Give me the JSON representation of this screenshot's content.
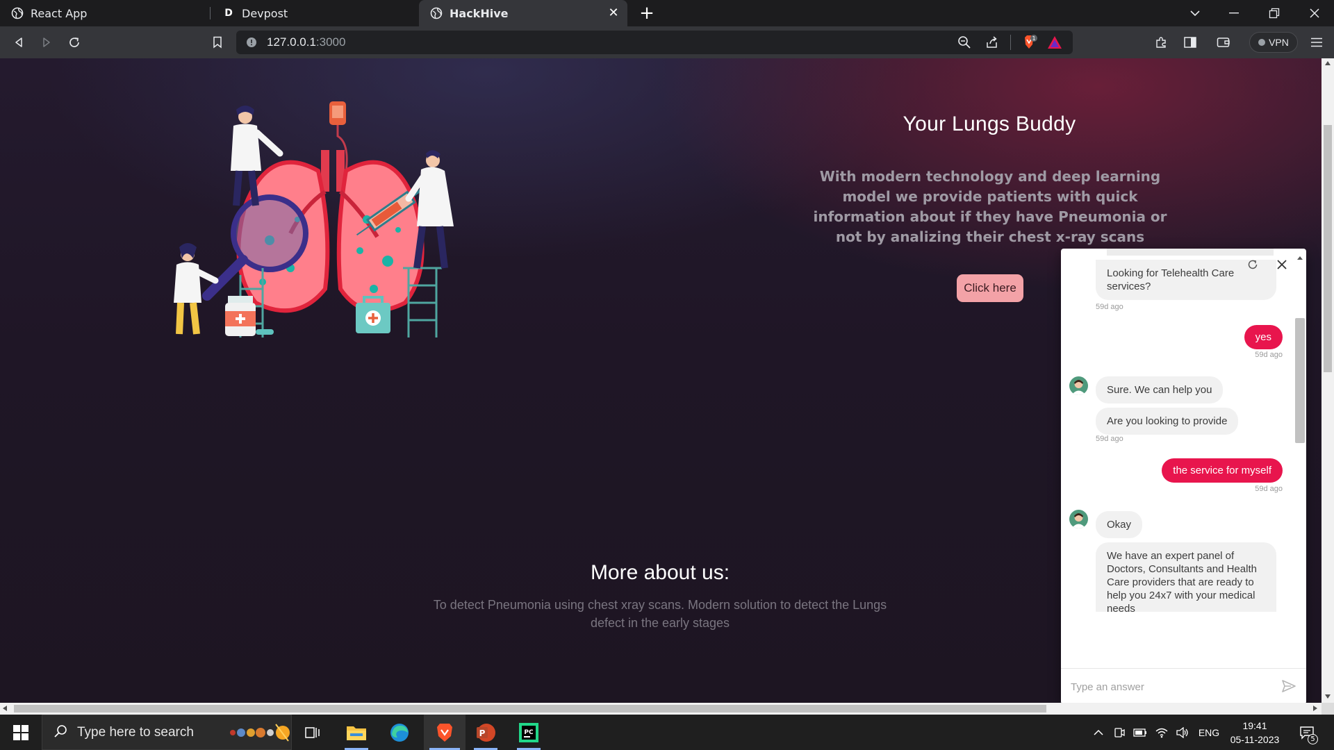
{
  "browser": {
    "tabs": [
      {
        "label": "React App",
        "icon": "globe-icon"
      },
      {
        "label": "Devpost",
        "icon": "devpost-d-icon",
        "icon_letter": "D"
      },
      {
        "label": "HackHive",
        "icon": "globe-icon",
        "active": true
      }
    ],
    "url_host": "127.0.0.1",
    "url_port": ":3000",
    "vpn_label": "VPN",
    "shield_count": "1"
  },
  "hero": {
    "title": "Your Lungs Buddy",
    "description": "With modern technology and deep learning model we provide patients with quick information about if they have Pneumonia or not by analizing their chest x-ray scans",
    "cta_label": "Click here"
  },
  "about": {
    "title": "More about us:",
    "description": "To detect Pneumonia using chest xray scans. Modern solution to detect the Lungs defect in the early stages"
  },
  "chat": {
    "messages": [
      {
        "from": "agent",
        "text": "Looking for Telehealth Care services?",
        "time": "59d ago"
      },
      {
        "from": "user",
        "text": "yes",
        "time": "59d ago"
      },
      {
        "from": "agent",
        "text": "Sure. We can help you"
      },
      {
        "from": "agent",
        "text": "Are you looking to provide",
        "time": "59d ago"
      },
      {
        "from": "user",
        "text": "the service for myself",
        "time": "59d ago"
      },
      {
        "from": "agent",
        "text": "Okay"
      },
      {
        "from": "agent",
        "text": "We have an expert panel of Doctors, Consultants and Health Care providers that are ready to help you 24x7 with your medical needs"
      }
    ],
    "input_placeholder": "Type an answer"
  },
  "taskbar": {
    "search_placeholder": "Type here to search",
    "language": "ENG",
    "time": "19:41",
    "date": "05-11-2023",
    "notification_count": "5"
  },
  "colors": {
    "accent_pink": "#e8154d",
    "cta_bg": "#f3a2a7",
    "page_bg": "#1f1626"
  }
}
